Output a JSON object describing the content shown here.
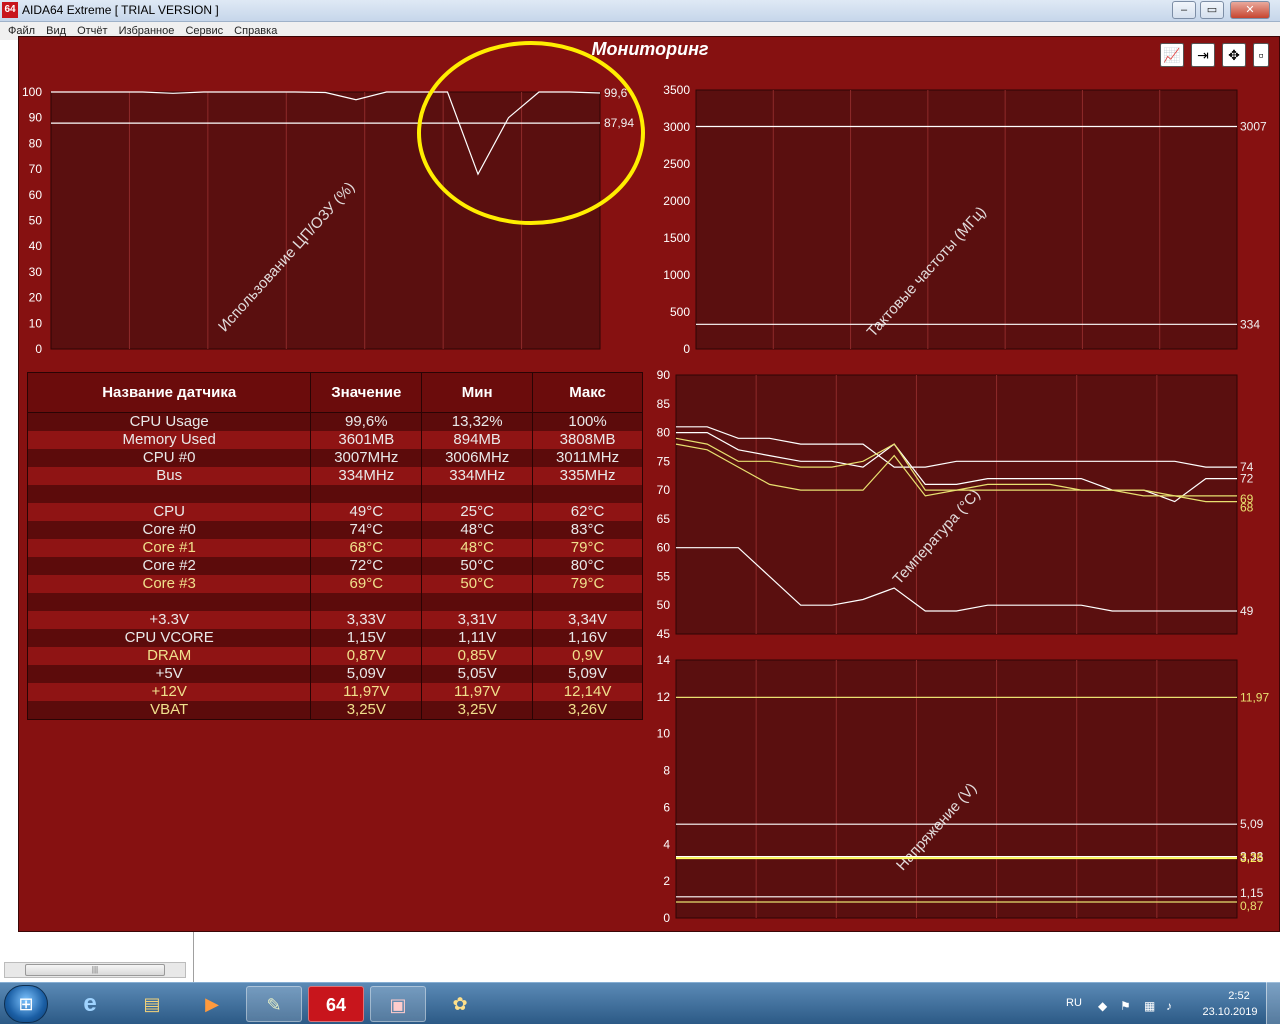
{
  "app": {
    "logo_text": "64",
    "title": "AIDA64 Extreme  [ TRIAL VERSION ]",
    "menu": [
      "Файл",
      "Вид",
      "Отчёт",
      "Избранное",
      "Сервис",
      "Справка"
    ],
    "controls": {
      "minimize": "–",
      "maximize": "▭",
      "close": "✕"
    },
    "hscroll_grip": "|||"
  },
  "monitor": {
    "title": "Мониторинг",
    "buttons": [
      "📈",
      "⇥",
      "✥",
      "▫"
    ]
  },
  "charts": {
    "cpu_ram": {
      "axis_label": "Использование ЦП/ОЗУ (%)",
      "ticks": [
        "100",
        "90",
        "80",
        "70",
        "60",
        "50",
        "40",
        "30",
        "20",
        "10",
        "0"
      ],
      "end_labels": [
        "99,6",
        "87,94"
      ]
    },
    "clock": {
      "axis_label": "Тактовые частоты (МГц)",
      "ticks": [
        "3500",
        "3000",
        "2500",
        "2000",
        "1500",
        "1000",
        "500",
        "0"
      ],
      "end_labels": [
        "3007",
        "334"
      ]
    },
    "temp": {
      "axis_label": "Температура (°C)",
      "ticks": [
        "90",
        "85",
        "80",
        "75",
        "70",
        "65",
        "60",
        "55",
        "50",
        "45"
      ],
      "end_labels": [
        "74",
        "72",
        "69",
        "68",
        "49"
      ]
    },
    "volt": {
      "axis_label": "Напряжение (V)",
      "ticks": [
        "14",
        "12",
        "10",
        "8",
        "6",
        "4",
        "2",
        "0"
      ],
      "end_labels": [
        "11,97",
        "5,09",
        "3,33",
        "3,25",
        "1,15",
        "0,87"
      ]
    }
  },
  "chart_data": [
    {
      "type": "line",
      "ylabel": "Использование ЦП/ОЗУ (%)",
      "ylim": [
        0,
        100
      ],
      "series": [
        {
          "values": [
            100,
            100,
            100,
            100,
            99.5,
            100,
            100,
            100,
            100,
            99.8,
            97,
            100,
            100,
            100,
            68,
            90,
            100,
            100,
            99.6
          ]
        },
        {
          "values": [
            87.9,
            87.9,
            87.9,
            87.9,
            87.9,
            87.9,
            87.9,
            87.9,
            87.9,
            87.9,
            87.9,
            87.9,
            87.9,
            87.9,
            87.9,
            87.9,
            87.9,
            87.9,
            87.94
          ]
        }
      ]
    },
    {
      "type": "line",
      "ylabel": "Тактовые частоты (МГц)",
      "ylim": [
        0,
        3500
      ],
      "series": [
        {
          "values": [
            3007,
            3007,
            3007,
            3007,
            3007,
            3007,
            3007,
            3007,
            3007,
            3007
          ]
        },
        {
          "values": [
            334,
            334,
            334,
            334,
            334,
            334,
            334,
            334,
            334,
            334
          ]
        }
      ]
    },
    {
      "type": "line",
      "ylabel": "Температура (°C)",
      "ylim": [
        45,
        90
      ],
      "series": [
        {
          "color": "#ffffff",
          "values": [
            81,
            81,
            79,
            79,
            78,
            78,
            78,
            74,
            74,
            75,
            75,
            75,
            75,
            75,
            75,
            75,
            75,
            74,
            74
          ]
        },
        {
          "color": "#ffffff",
          "values": [
            80,
            80,
            77,
            76,
            75,
            75,
            74,
            78,
            71,
            71,
            72,
            72,
            72,
            72,
            70,
            70,
            68,
            72,
            72
          ]
        },
        {
          "color": "#e8e070",
          "values": [
            79,
            78,
            75,
            75,
            74,
            74,
            75,
            78,
            70,
            70,
            71,
            71,
            71,
            70,
            70,
            70,
            69,
            69,
            69
          ]
        },
        {
          "color": "#e8e070",
          "values": [
            78,
            77,
            74,
            71,
            70,
            70,
            70,
            76,
            69,
            70,
            70,
            70,
            70,
            70,
            70,
            69,
            69,
            68,
            68
          ]
        },
        {
          "color": "#ffffff",
          "values": [
            60,
            60,
            60,
            55,
            50,
            50,
            51,
            53,
            49,
            49,
            50,
            50,
            50,
            50,
            49,
            49,
            49,
            49,
            49
          ]
        }
      ]
    },
    {
      "type": "line",
      "ylabel": "Напряжение (V)",
      "ylim": [
        0,
        14
      ],
      "series": [
        {
          "color": "#e8e070",
          "values": [
            11.97,
            11.97,
            11.97,
            11.97,
            11.97,
            11.97,
            11.97,
            11.97,
            11.97,
            11.97
          ]
        },
        {
          "color": "#ffffff",
          "values": [
            5.09,
            5.09,
            5.09,
            5.09,
            5.09,
            5.09,
            5.09,
            5.09,
            5.09,
            5.09
          ]
        },
        {
          "color": "#ffffff",
          "values": [
            3.33,
            3.33,
            3.33,
            3.33,
            3.33,
            3.33,
            3.33,
            3.33,
            3.33,
            3.33
          ]
        },
        {
          "color": "#ffff60",
          "values": [
            3.25,
            3.25,
            3.25,
            3.25,
            3.25,
            3.25,
            3.25,
            3.25,
            3.25,
            3.25
          ]
        },
        {
          "color": "#ffffff",
          "values": [
            1.15,
            1.15,
            1.15,
            1.15,
            1.15,
            1.15,
            1.15,
            1.15,
            1.15,
            1.15
          ]
        },
        {
          "color": "#e8e070",
          "values": [
            0.87,
            0.87,
            0.87,
            0.87,
            0.87,
            0.87,
            0.87,
            0.87,
            0.87,
            0.87
          ]
        }
      ]
    }
  ],
  "table": {
    "headers": [
      "Название датчика",
      "Значение",
      "Мин",
      "Макс"
    ],
    "rows": [
      {
        "name": "CPU Usage",
        "value": "99,6%",
        "min": "13,32%",
        "max": "100%",
        "yellow": false
      },
      {
        "name": "Memory Used",
        "value": "3601MB",
        "min": "894MB",
        "max": "3808MB",
        "yellow": false
      },
      {
        "name": "CPU #0",
        "value": "3007MHz",
        "min": "3006MHz",
        "max": "3011MHz",
        "yellow": false
      },
      {
        "name": "Bus",
        "value": "334MHz",
        "min": "334MHz",
        "max": "335MHz",
        "yellow": false
      },
      {
        "name": "",
        "value": "",
        "min": "",
        "max": "",
        "yellow": false
      },
      {
        "name": "CPU",
        "value": "49°C",
        "min": "25°C",
        "max": "62°C",
        "yellow": false
      },
      {
        "name": "Core #0",
        "value": "74°C",
        "min": "48°C",
        "max": "83°C",
        "yellow": false
      },
      {
        "name": "Core #1",
        "value": "68°C",
        "min": "48°C",
        "max": "79°C",
        "yellow": true
      },
      {
        "name": "Core #2",
        "value": "72°C",
        "min": "50°C",
        "max": "80°C",
        "yellow": false
      },
      {
        "name": "Core #3",
        "value": "69°C",
        "min": "50°C",
        "max": "79°C",
        "yellow": true
      },
      {
        "name": "",
        "value": "",
        "min": "",
        "max": "",
        "yellow": false
      },
      {
        "name": "+3.3V",
        "value": "3,33V",
        "min": "3,31V",
        "max": "3,34V",
        "yellow": false
      },
      {
        "name": "CPU VCORE",
        "value": "1,15V",
        "min": "1,11V",
        "max": "1,16V",
        "yellow": false
      },
      {
        "name": "DRAM",
        "value": "0,87V",
        "min": "0,85V",
        "max": "0,9V",
        "yellow": true
      },
      {
        "name": "+5V",
        "value": "5,09V",
        "min": "5,05V",
        "max": "5,09V",
        "yellow": false
      },
      {
        "name": "+12V",
        "value": "11,97V",
        "min": "11,97V",
        "max": "12,14V",
        "yellow": true
      },
      {
        "name": "VBAT",
        "value": "3,25V",
        "min": "3,25V",
        "max": "3,26V",
        "yellow": true
      }
    ]
  },
  "taskbar": {
    "start": "⊞",
    "items": [
      {
        "name": "ie-icon",
        "glyph": "e"
      },
      {
        "name": "explorer-icon",
        "glyph": "▤"
      },
      {
        "name": "media-player-icon",
        "glyph": "▶"
      },
      {
        "name": "notes-icon",
        "glyph": "✎"
      },
      {
        "name": "aida64-icon",
        "glyph": "64"
      },
      {
        "name": "monitor-app-icon",
        "glyph": "▣"
      },
      {
        "name": "paint-icon",
        "glyph": "✿"
      }
    ],
    "language": "RU",
    "time": "2:52",
    "date": "23.10.2019"
  },
  "colors": {
    "window_bg": "#861111",
    "plot_bg": "#5a0f0f",
    "grid": "#8e2a2a",
    "line_white": "#ffffff",
    "line_yellow": "#e8e070",
    "highlight_circle": "#ffee00"
  }
}
